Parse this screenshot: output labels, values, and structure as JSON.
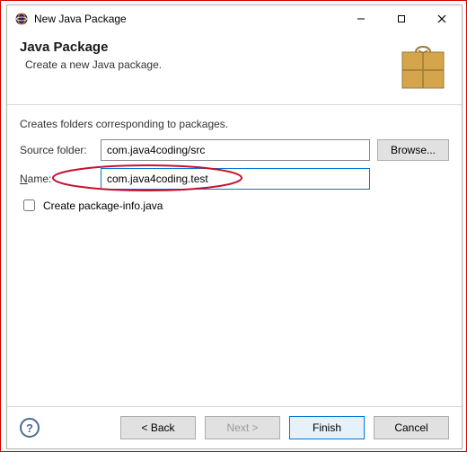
{
  "window": {
    "title": "New Java Package"
  },
  "header": {
    "heading": "Java Package",
    "subheading": "Create a new Java package."
  },
  "body": {
    "description": "Creates folders corresponding to packages.",
    "source_label": "Source folder:",
    "source_value": "com.java4coding/src",
    "browse_label": "Browse...",
    "name_label": "Name:",
    "name_value": "com.java4coding.test",
    "checkbox_label": "Create package-info.java"
  },
  "footer": {
    "back": "< Back",
    "next": "Next >",
    "finish": "Finish",
    "cancel": "Cancel",
    "help_glyph": "?"
  }
}
